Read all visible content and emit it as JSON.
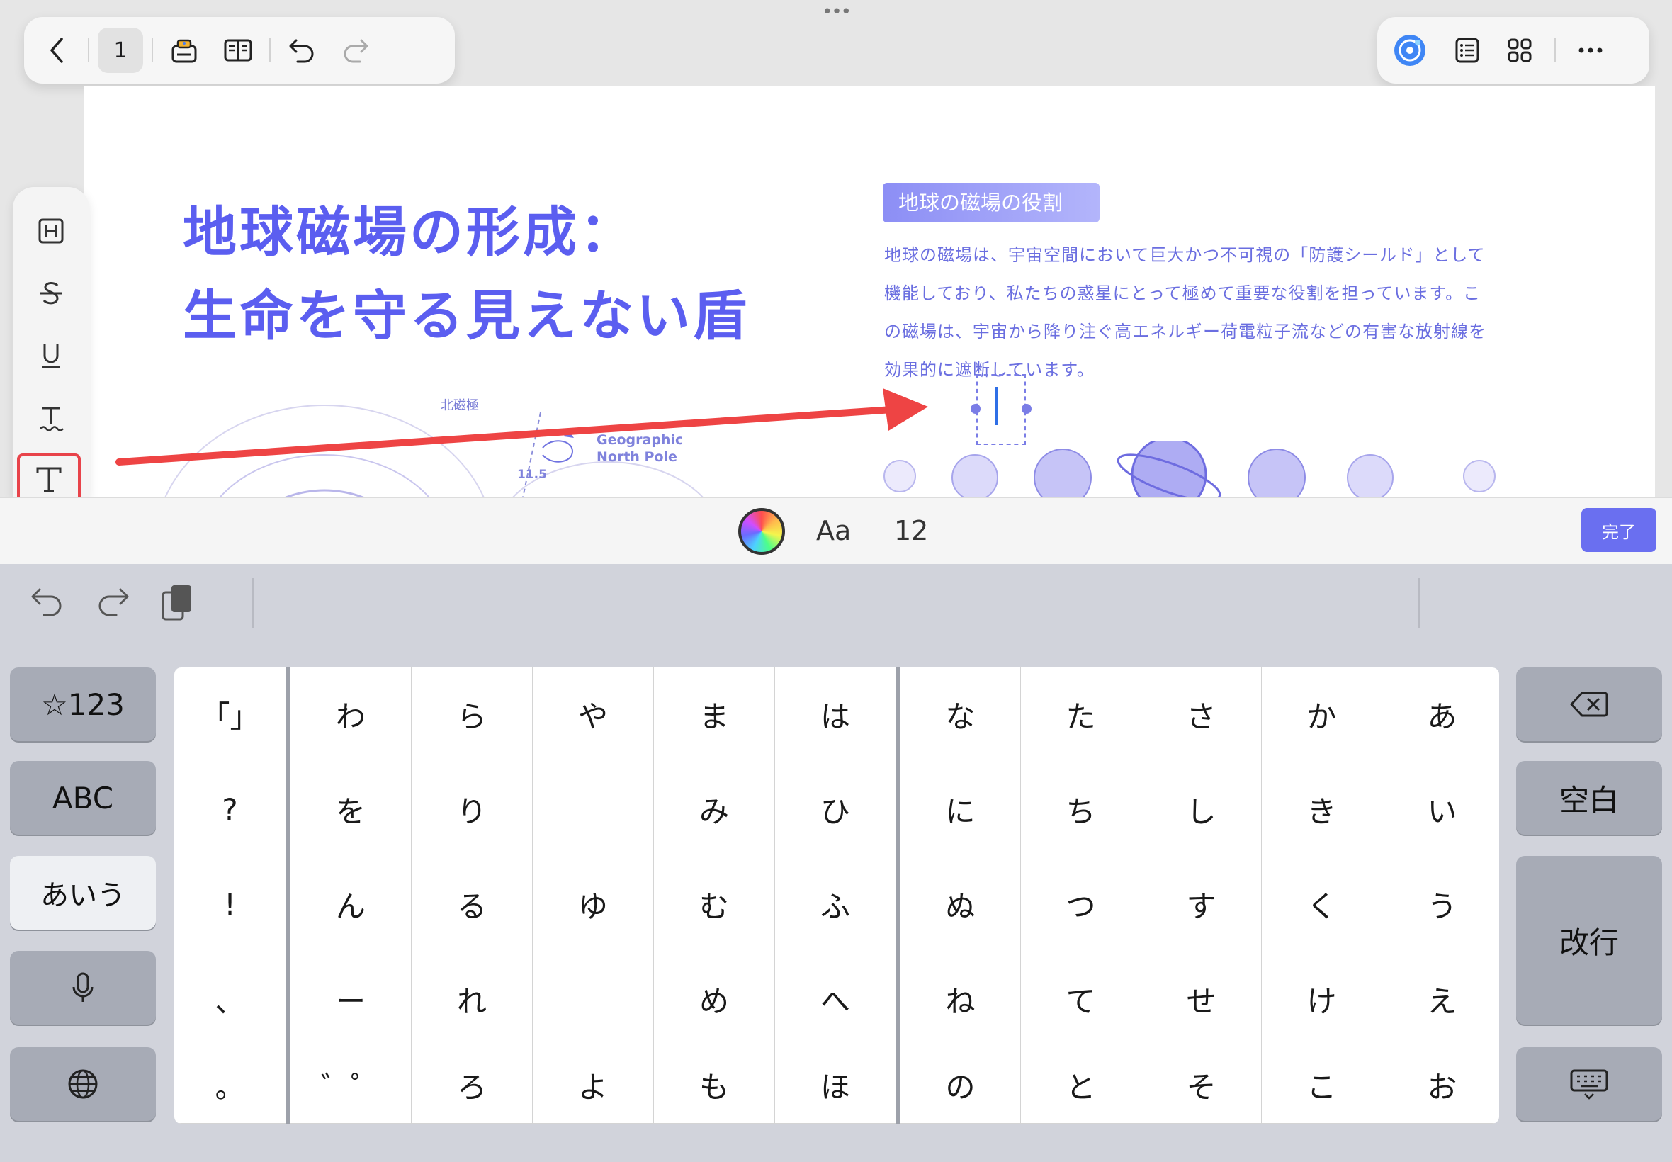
{
  "top_toolbar": {
    "page_number": "1",
    "handle": "•••"
  },
  "page": {
    "title_line1": "地球磁場の形成：",
    "title_line2": "生命を守る見えない盾",
    "section_tag": "地球の磁場の役割",
    "paragraph_lines": [
      "地球の磁場は、宇宙空間において巨大かつ不可視の「防護シールド」として",
      "機能しており、私たちの惑星にとって極めて重要な役割を担っています。こ",
      "の磁場は、宇宙から降り注ぐ高エネルギー荷電粒子流などの有害な放射線を",
      "効果的に遮断しています。"
    ],
    "diagram_label_north_magnetic": "北磁極",
    "diagram_label_geo_1": "Geographic",
    "diagram_label_geo_2": "North Pole",
    "diagram_angle": "11.5"
  },
  "format_bar": {
    "font_label": "Aa",
    "font_size": "12",
    "done_label": "完了"
  },
  "keyboard": {
    "left_keys": [
      "☆123",
      "ABC",
      "あいう"
    ],
    "right_keys": {
      "space": "空白",
      "return": "改行"
    },
    "punct_col": [
      "「」",
      "?",
      "!",
      "、",
      "。"
    ],
    "cols": [
      [
        "わ",
        "を",
        "ん",
        "ー",
        "゛゜"
      ],
      [
        "ら",
        "り",
        "る",
        "れ",
        "ろ"
      ],
      [
        "や",
        "",
        "ゆ",
        "",
        "よ"
      ],
      [
        "ま",
        "み",
        "む",
        "め",
        "も"
      ],
      [
        "は",
        "ひ",
        "ふ",
        "へ",
        "ほ"
      ],
      [
        "な",
        "に",
        "ぬ",
        "ね",
        "の"
      ],
      [
        "た",
        "ち",
        "つ",
        "て",
        "と"
      ],
      [
        "さ",
        "し",
        "す",
        "せ",
        "そ"
      ],
      [
        "か",
        "き",
        "く",
        "け",
        "こ"
      ],
      [
        "あ",
        "い",
        "う",
        "え",
        "お"
      ]
    ]
  },
  "colors": {
    "accent": "#5b5ef0",
    "highlight_box": "#e8434a",
    "arrow": "#ee4444",
    "done_button": "#6a6ff0"
  },
  "icons": {
    "back": "chevron-left-icon",
    "ai": "ai-assistant-icon",
    "outline": "list-icon",
    "grid": "grid-icon",
    "more": "ellipsis-icon"
  }
}
